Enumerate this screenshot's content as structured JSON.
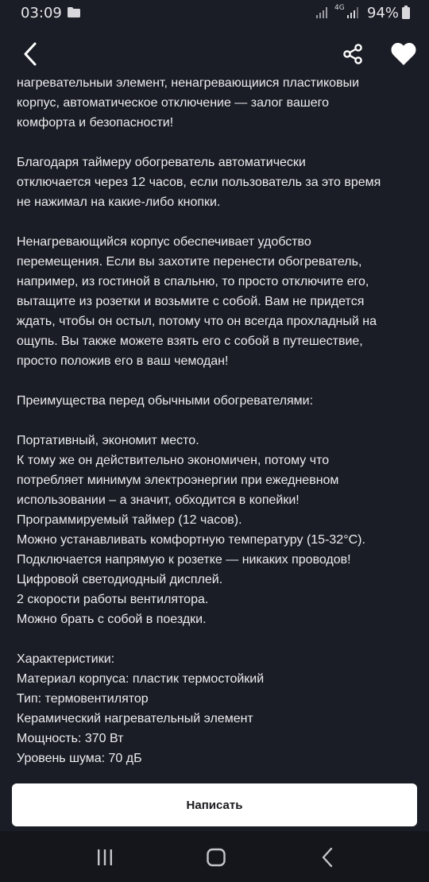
{
  "status_bar": {
    "time": "03:09",
    "network_type": "4G",
    "battery": "94%"
  },
  "app_bar": {
    "back_icon": "chevron-left-icon",
    "share_icon": "share-icon",
    "favorite_icon": "heart-icon"
  },
  "description": {
    "paragraph_1": [
      "нагревательный элемент, ненагревающийся пластиковый",
      "корпус, автоматическое отключение — залог вашего",
      "комфорта и безопасности!"
    ],
    "paragraph_2": [
      "Благодаря таймеру обогреватель автоматически",
      "отключается через 12 часов, если пользователь за это время",
      "не нажимал на какие-либо кнопки."
    ],
    "paragraph_3": [
      "Ненагревающийся корпус обеспечивает удобство",
      "перемещения. Если вы захотите перенести обогреватель,",
      "например, из гостиной в спальню, то просто отключите его,",
      "вытащите из розетки и возьмите с собой. Вам не придется",
      "ждать, чтобы он остыл, потому что он всегда прохладный на",
      "ощупь. Вы также можете взять его с собой в путешествие,",
      "просто положив его в ваш чемодан!"
    ],
    "advantages_heading": "Преимущества перед обычными обогревателями:",
    "advantages": [
      "Портативный, экономит место.",
      "К тому же он действительно экономичен, потому что",
      "потребляет минимум электроэнергии при ежедневном",
      "использовании – а значит, обходится в копейки!",
      "Программируемый таймер (12 часов).",
      "Можно устанавливать комфортную температуру (15-32°C).",
      "Подключается напрямую к розетке — никаких проводов!",
      "Цифровой светодиодный дисплей.",
      "2 скорости работы вентилятора.",
      "Можно брать с собой в поездки."
    ],
    "specs_heading": "Характеристики:",
    "specs": [
      "Материал корпуса: пластик термостойкий",
      "Тип: термовентилятор",
      "Керамический нагревательный элемент",
      "Мощность: 370 Вт",
      "Уровень шума: 70 дБ"
    ]
  },
  "write_button": {
    "label": "Написать"
  },
  "nav_bar": {
    "recents_icon": "recents-icon",
    "home_icon": "home-icon",
    "back_icon": "back-icon"
  },
  "colors": {
    "background": "#1b1d26",
    "text": "#ececee",
    "button": "#ffffff",
    "nav_bar": "#15161c"
  }
}
